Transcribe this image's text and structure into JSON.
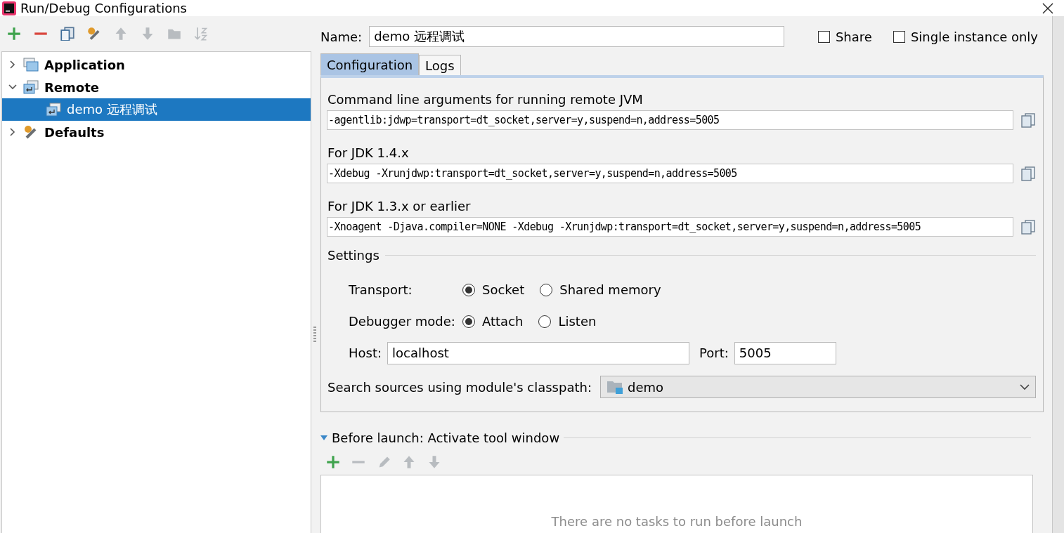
{
  "window": {
    "title": "Run/Debug Configurations"
  },
  "toolbar": [
    {
      "kind": "add",
      "disabled": false
    },
    {
      "kind": "remove",
      "disabled": false
    },
    {
      "kind": "copy",
      "disabled": false
    },
    {
      "kind": "edit-defaults",
      "disabled": false
    },
    {
      "kind": "up",
      "disabled": true
    },
    {
      "kind": "down",
      "disabled": true
    },
    {
      "kind": "folder",
      "disabled": true
    },
    {
      "kind": "sort",
      "disabled": true
    }
  ],
  "tree": [
    {
      "label": "Application",
      "kind": "application",
      "expanded": false,
      "selected": false
    },
    {
      "label": "Remote",
      "kind": "remote",
      "expanded": true,
      "selected": false,
      "children": [
        {
          "label": "demo 远程调试",
          "kind": "remote",
          "selected": true
        }
      ]
    },
    {
      "label": "Defaults",
      "kind": "defaults",
      "expanded": false,
      "selected": false
    }
  ],
  "name": {
    "label": "Name:",
    "value": "demo 远程调试"
  },
  "options": [
    {
      "label": "Share",
      "checked": false
    },
    {
      "label": "Single instance only",
      "checked": false
    }
  ],
  "tabs": [
    {
      "label": "Configuration",
      "selected": true
    },
    {
      "label": "Logs",
      "selected": false
    }
  ],
  "arguments": [
    {
      "label": "Command line arguments for running remote JVM",
      "value": "-agentlib:jdwp=transport=dt_socket,server=y,suspend=n,address=5005"
    },
    {
      "label": "For JDK 1.4.x",
      "value": "-Xdebug -Xrunjdwp:transport=dt_socket,server=y,suspend=n,address=5005"
    },
    {
      "label": "For JDK 1.3.x or earlier",
      "value": "-Xnoagent -Djava.compiler=NONE -Xdebug -Xrunjdwp:transport=dt_socket,server=y,suspend=n,address=5005"
    }
  ],
  "settings": {
    "title": "Settings",
    "transport": {
      "label": "Transport:",
      "options": [
        {
          "label": "Socket",
          "selected": true
        },
        {
          "label": "Shared memory",
          "selected": false
        }
      ]
    },
    "debugger_mode": {
      "label": "Debugger mode:",
      "options": [
        {
          "label": "Attach",
          "selected": true
        },
        {
          "label": "Listen",
          "selected": false
        }
      ]
    },
    "host": {
      "label": "Host:",
      "value": "localhost"
    },
    "port": {
      "label": "Port:",
      "value": "5005"
    },
    "module": {
      "label": "Search sources using module's classpath:",
      "value": "demo"
    }
  },
  "before_launch": {
    "title": "Before launch: Activate tool window",
    "expanded": true,
    "toolbar": [
      {
        "kind": "add",
        "disabled": false
      },
      {
        "kind": "remove",
        "disabled": true
      },
      {
        "kind": "edit",
        "disabled": true
      },
      {
        "kind": "up",
        "disabled": true
      },
      {
        "kind": "down",
        "disabled": true
      }
    ],
    "empty_text": "There are no tasks to run before launch"
  }
}
